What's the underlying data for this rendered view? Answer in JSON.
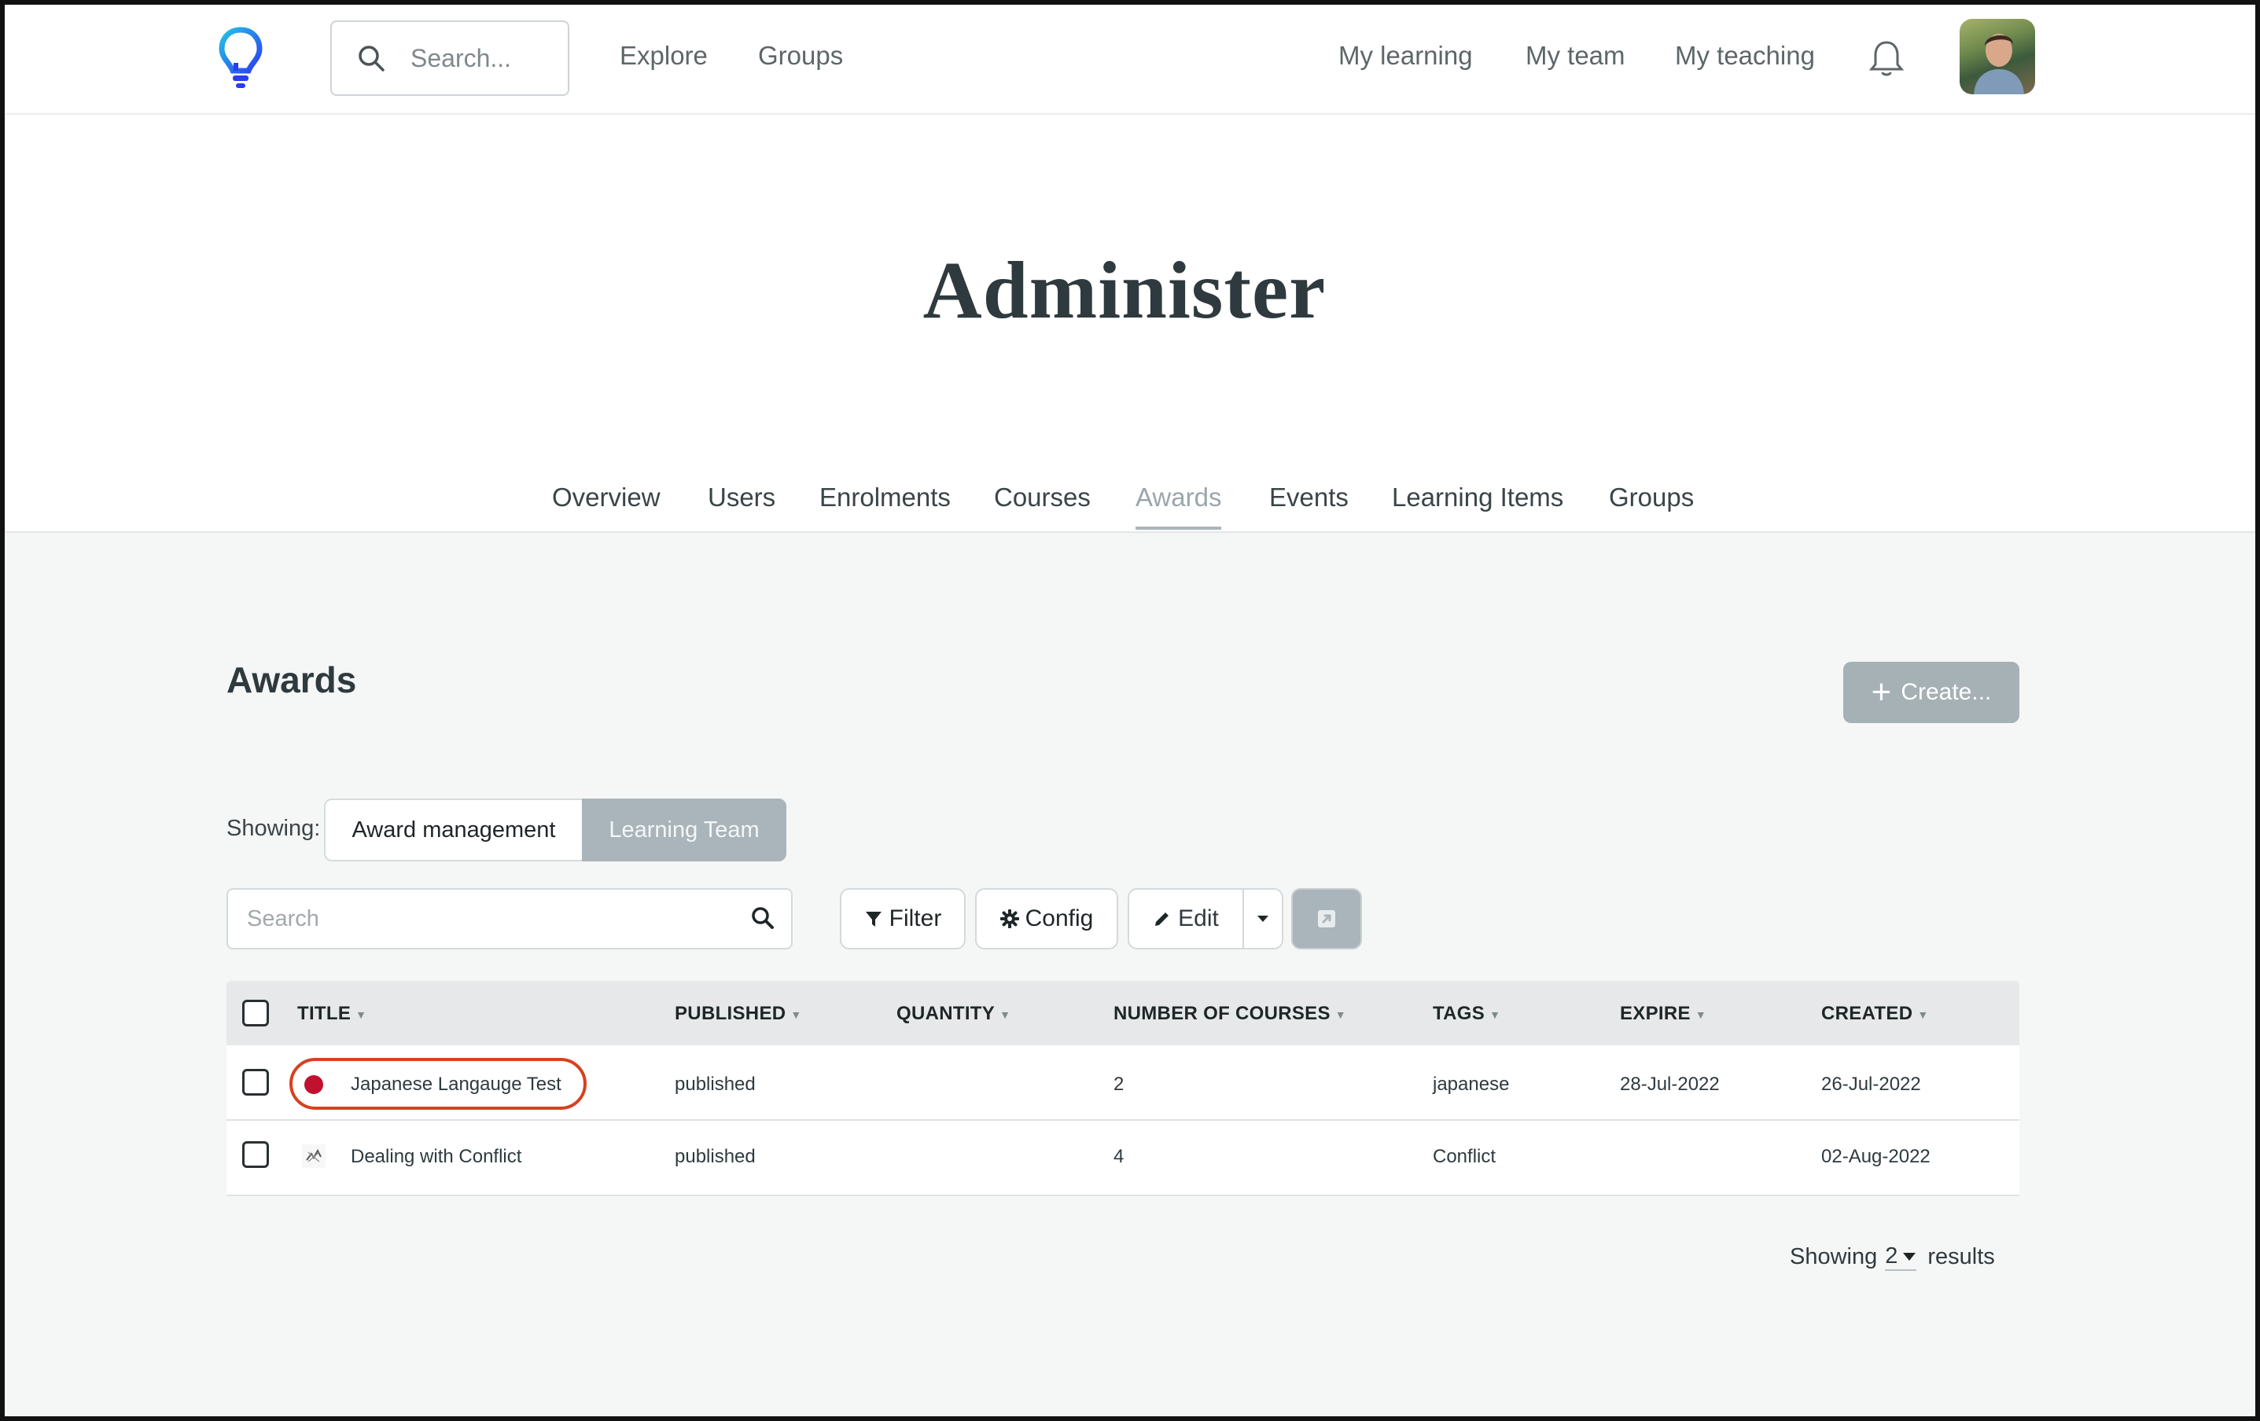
{
  "nav": {
    "search_placeholder": "Search...",
    "links": [
      "Explore",
      "Groups",
      "My learning",
      "My team",
      "My teaching"
    ],
    "icons": {
      "logo": "lightbulb-logo",
      "search": "search-icon",
      "notifications": "bell-icon",
      "avatar": "user-avatar"
    }
  },
  "header": {
    "title": "Administer"
  },
  "tabs": [
    {
      "label": "Overview",
      "active": false
    },
    {
      "label": "Users",
      "active": false
    },
    {
      "label": "Enrolments",
      "active": false
    },
    {
      "label": "Courses",
      "active": false
    },
    {
      "label": "Awards",
      "active": true
    },
    {
      "label": "Events",
      "active": false
    },
    {
      "label": "Learning Items",
      "active": false
    },
    {
      "label": "Groups",
      "active": false
    }
  ],
  "awards": {
    "section_title": "Awards",
    "create_label": "Create...",
    "showing_label": "Showing:",
    "segments": [
      "Award management",
      "Learning Team"
    ],
    "active_segment": "Learning Team",
    "search_placeholder": "Search",
    "toolbar": {
      "filter": "Filter",
      "config": "Config",
      "edit": "Edit"
    },
    "columns": [
      "TITLE",
      "PUBLISHED",
      "QUANTITY",
      "NUMBER OF COURSES",
      "TAGS",
      "EXPIRE",
      "CREATED"
    ],
    "rows": [
      {
        "title": "Japanese Langauge Test",
        "published": "published",
        "quantity": "",
        "courses": "2",
        "tags": "japanese",
        "expire": "28-Jul-2022",
        "created": "26-Jul-2022",
        "icon": "red-circle-badge",
        "highlighted": true
      },
      {
        "title": "Dealing with Conflict",
        "published": "published",
        "quantity": "",
        "courses": "4",
        "tags": "Conflict",
        "expire": "",
        "created": "02-Aug-2022",
        "icon": "conflict-badge",
        "highlighted": false
      }
    ],
    "footer": {
      "prefix": "Showing",
      "count": "2",
      "suffix": "results"
    }
  },
  "colors": {
    "accent_muted": "#a9b5ba",
    "highlight": "#d8401f",
    "logo_blue": "#2b6cf6",
    "logo_cyan": "#22c3e6",
    "badge_red": "#c0122f"
  }
}
